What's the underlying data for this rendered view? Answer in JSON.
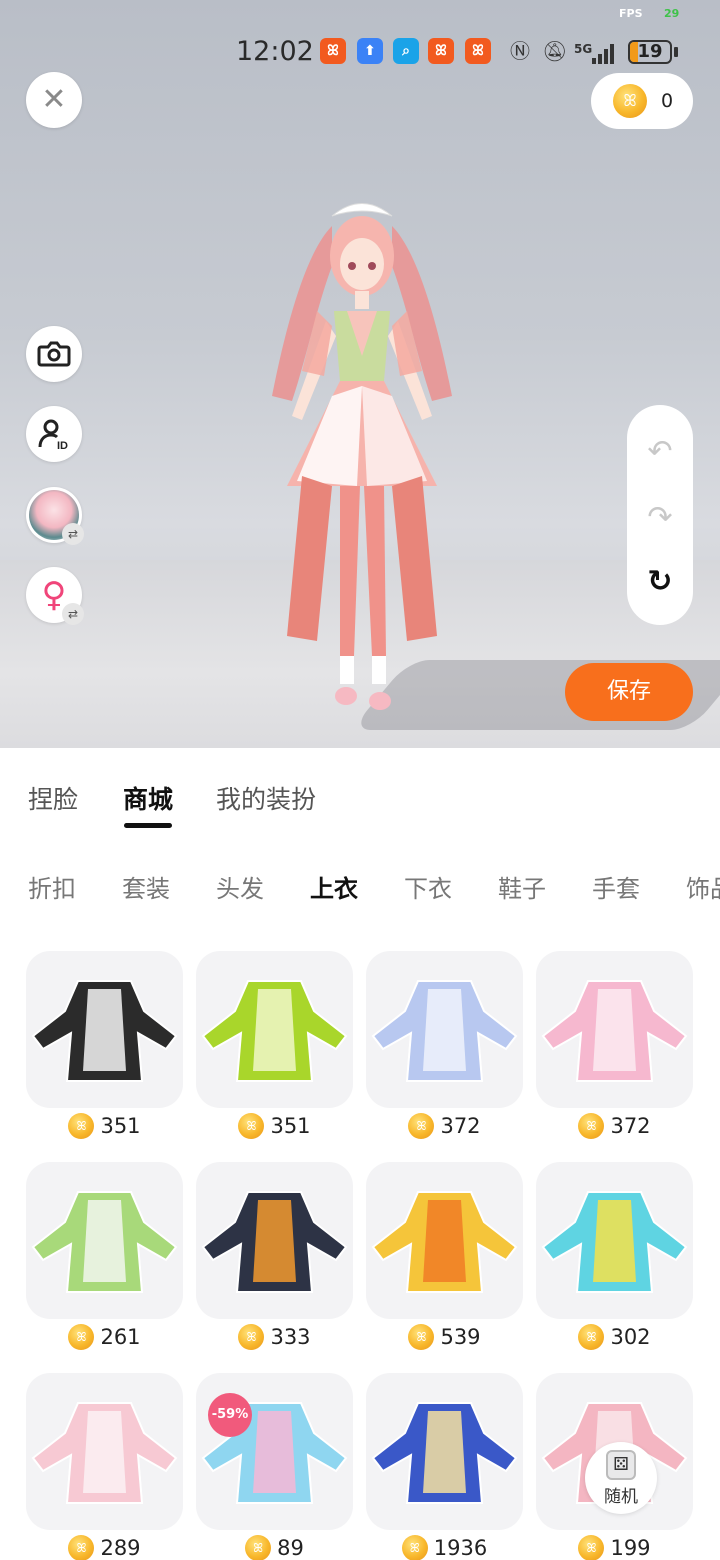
{
  "status_bar": {
    "fps_label": "FPS",
    "fps_value": "29",
    "time": "12:02",
    "battery": "19",
    "network": "5G"
  },
  "wallet": {
    "coins": "0"
  },
  "actions": {
    "save_label": "保存"
  },
  "main_tabs": [
    {
      "label": "捏脸",
      "active": false
    },
    {
      "label": "商城",
      "active": true
    },
    {
      "label": "我的装扮",
      "active": false
    }
  ],
  "sub_tabs": [
    {
      "label": "折扣",
      "active": false
    },
    {
      "label": "套装",
      "active": false
    },
    {
      "label": "头发",
      "active": false
    },
    {
      "label": "上衣",
      "active": true
    },
    {
      "label": "下衣",
      "active": false
    },
    {
      "label": "鞋子",
      "active": false
    },
    {
      "label": "手套",
      "active": false
    },
    {
      "label": "饰品",
      "active": false
    }
  ],
  "items": [
    {
      "price": "351",
      "colors": [
        "#2b2b2b",
        "#f4f4f4"
      ]
    },
    {
      "price": "351",
      "colors": [
        "#a9d62b",
        "#f0f7c8"
      ]
    },
    {
      "price": "372",
      "colors": [
        "#b8c8f0",
        "#eef2fb"
      ]
    },
    {
      "price": "372",
      "colors": [
        "#f6b8cf",
        "#fbeaf1"
      ]
    },
    {
      "price": "261",
      "colors": [
        "#a8d97a",
        "#f2f6ee"
      ]
    },
    {
      "price": "333",
      "colors": [
        "#2d3345",
        "#f39a2e"
      ]
    },
    {
      "price": "539",
      "colors": [
        "#f5c53a",
        "#f07b26"
      ]
    },
    {
      "price": "302",
      "colors": [
        "#5fd4e2",
        "#f4e24a"
      ]
    },
    {
      "price": "289",
      "colors": [
        "#f7c9d3",
        "#fbf1f3"
      ]
    },
    {
      "price": "89",
      "colors": [
        "#8fd6f0",
        "#f7b7d6"
      ],
      "discount": "-59%"
    },
    {
      "price": "1936",
      "colors": [
        "#3a58c8",
        "#f6e1a0"
      ]
    },
    {
      "price": "199",
      "colors": [
        "#f4b6c2",
        "#f9e6ea"
      ]
    }
  ],
  "random": {
    "label": "随机"
  },
  "icons": {
    "close": "close-icon",
    "camera": "camera-icon",
    "profile_id": "profile-id-icon",
    "gender": "female-icon",
    "undo": "undo-icon",
    "redo": "redo-icon",
    "reset": "reset-icon",
    "dice": "dice-icon",
    "coin": "coin-icon"
  },
  "colors": {
    "accent": "#f86f1c",
    "discount": "#f15a7c",
    "coin": "#f8b72b"
  }
}
